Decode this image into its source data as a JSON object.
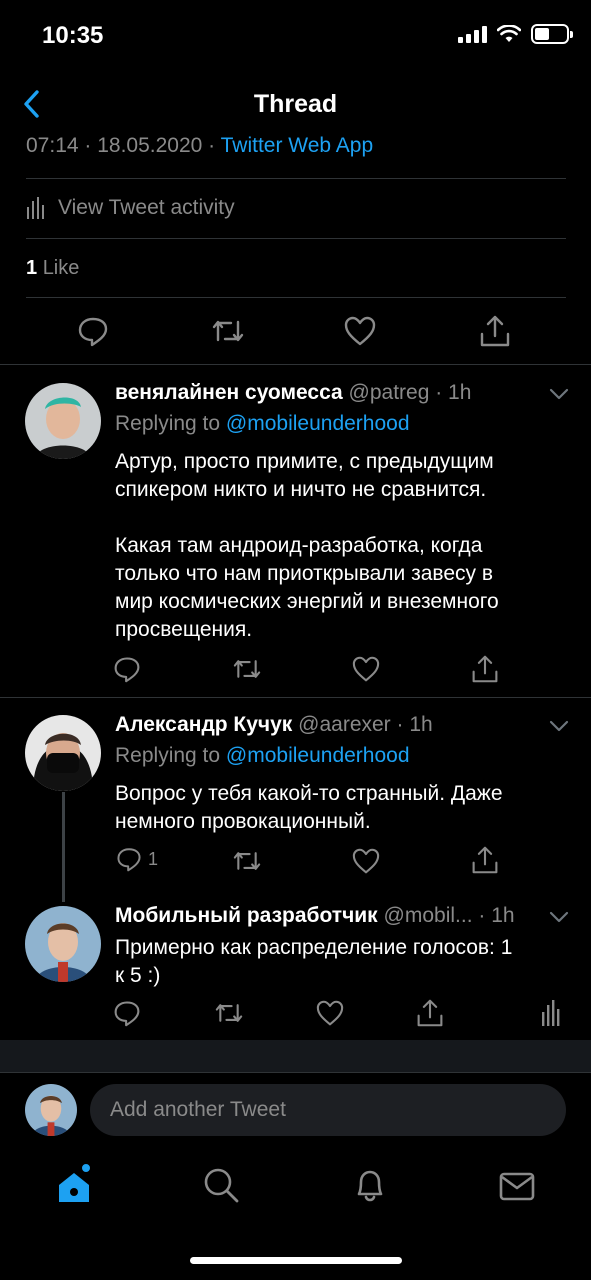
{
  "status_bar": {
    "time": "10:35"
  },
  "nav": {
    "title": "Thread"
  },
  "main_tweet": {
    "timestamp": "07:14 · 18.05.2020 ·",
    "client": "Twitter Web App",
    "activity_label": "View Tweet activity",
    "likes_count": "1",
    "likes_label": "Like"
  },
  "replies": [
    {
      "name": "венялайнен суомесса",
      "handle": "@patreg · 1h",
      "replying_prefix": "Replying to",
      "replying_to": "@mobileunderhood",
      "text": "Артур, просто примите, с предыдущим\nспикером никто и ничто не сравнится.\n\nКакая там андроид-разработка, когда\nтолько что нам приоткрывали завесу в\nмир космических энергий и внеземного\nпросвещения."
    },
    {
      "name": "Александр Кучук",
      "handle": "@aarexer · 1h",
      "replying_prefix": "Replying to",
      "replying_to": "@mobileunderhood",
      "text": "Вопрос у тебя какой-то странный. Даже\nнемного провокационный.",
      "reply_count": "1"
    },
    {
      "name": "Мобильный разработчик",
      "handle": "@mobil... · 1h",
      "text": "Примерно как распределение голосов: 1\nк 5 :)"
    }
  ],
  "composer": {
    "placeholder": "Add another Tweet"
  },
  "colors": {
    "accent": "#1da1f2",
    "background": "#000000",
    "muted": "#8a8a8a"
  }
}
